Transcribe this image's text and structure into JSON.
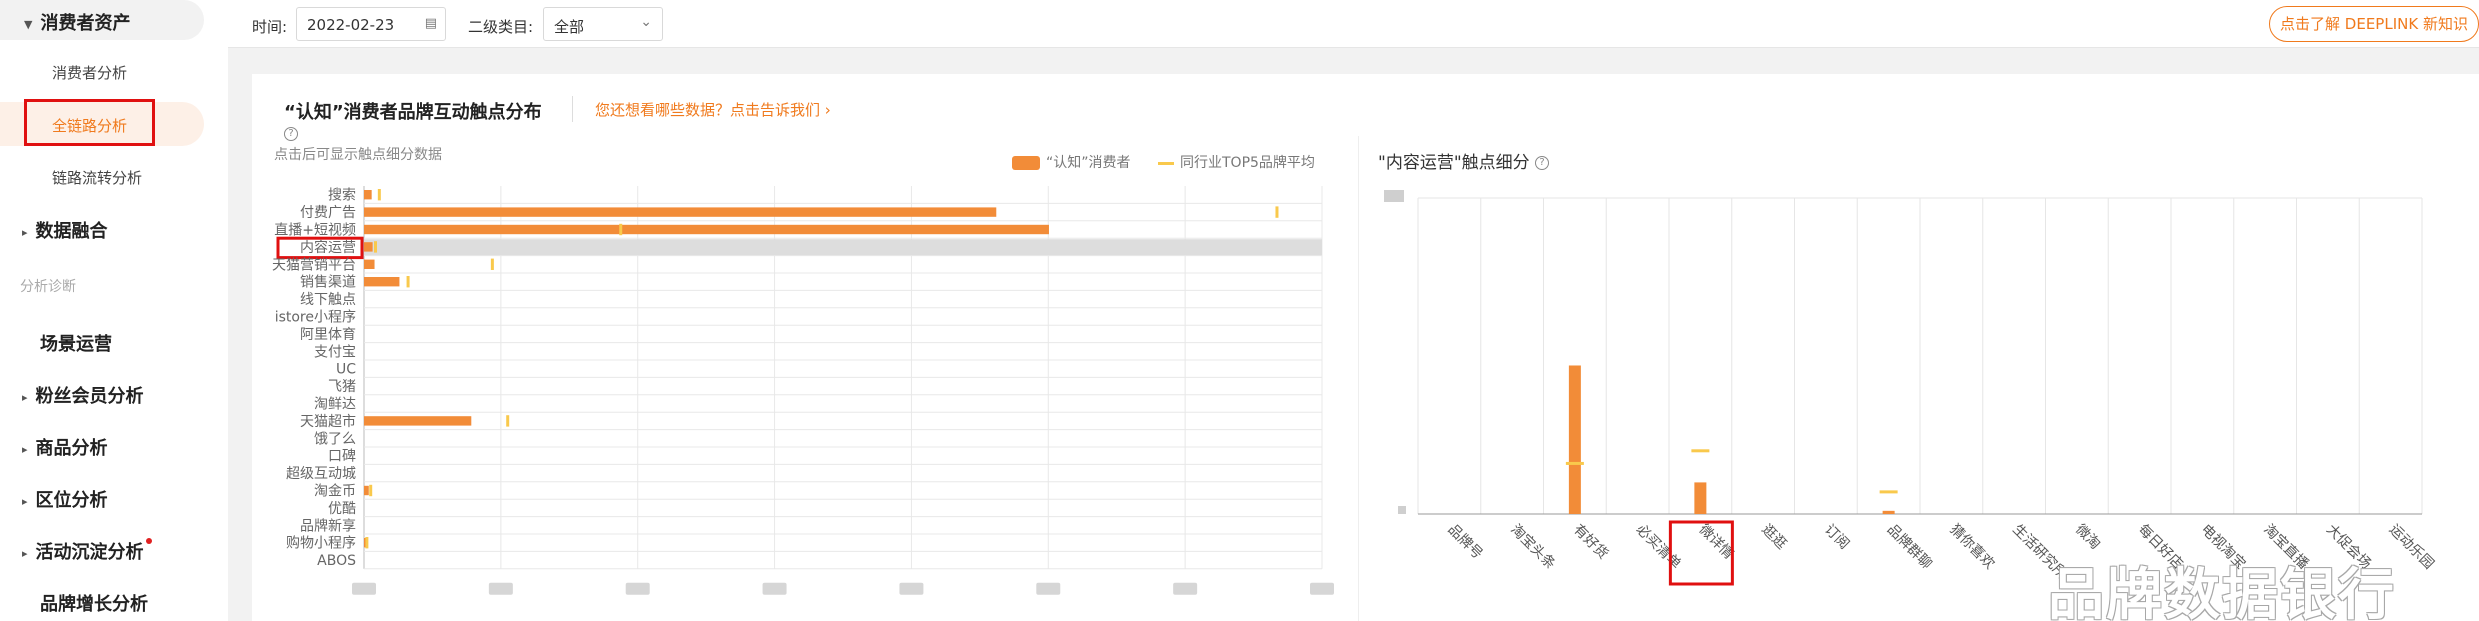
{
  "sidebar": {
    "group_consumer_assets": "消费者资产",
    "sub_consumer_analysis": "消费者分析",
    "sub_full_link": "全链路分析",
    "sub_link_flow": "链路流转分析",
    "group_data_fusion": "数据融合",
    "section_diagnosis": "分析诊断",
    "item_scene_ops": "场景运营",
    "group_fans": "粉丝会员分析",
    "group_product": "商品分析",
    "group_region": "区位分析",
    "group_activity": "活动沉淀分析",
    "group_brand_growth": "品牌增长分析"
  },
  "toolbar": {
    "time_label": "时间:",
    "date_value": "2022-02-23",
    "category_label": "二级类目:",
    "category_value": "全部",
    "deeplink_button": "点击了解 DEEPLINK 新知识"
  },
  "card": {
    "title": "“认知”消费者品牌互动触点分布",
    "feedback_link": "您还想看哪些数据？点击告诉我们",
    "hint": "点击后可显示触点细分数据"
  },
  "legend": {
    "consumers": "“认知”消费者",
    "top5_avg": "同行业TOP5品牌平均"
  },
  "colors": {
    "bar": "#f28c38",
    "avg_mark": "#f9c94c",
    "accent": "#f07a1d",
    "highlight": "#e01010",
    "selected_row": "#dddddd"
  },
  "chart_data": [
    {
      "type": "bar",
      "orientation": "horizontal",
      "categories": [
        "搜索",
        "付费广告",
        "直播+短视频",
        "内容运营",
        "天猫营销平台",
        "销售渠道",
        "线下触点",
        "istore小程序",
        "阿里体育",
        "支付宝",
        "UC",
        "飞猪",
        "淘鲜达",
        "天猫超市",
        "饿了么",
        "口碑",
        "超级互动城",
        "淘金币",
        "优酷",
        "品牌新享",
        "购物小程序",
        "ABOS"
      ],
      "series": [
        {
          "name": "“认知”消费者",
          "values": [
            0.8,
            66,
            71.5,
            0.9,
            1.1,
            3.7,
            0,
            0,
            0,
            0,
            0,
            0,
            0,
            11.2,
            0,
            0,
            0,
            0.5,
            0,
            0,
            0.4,
            0
          ]
        },
        {
          "name": "同行业TOP5品牌平均",
          "values": [
            1.6,
            95.3,
            26.8,
            1.2,
            13.4,
            4.6,
            0,
            0,
            0,
            0,
            0,
            0,
            0,
            15,
            0,
            0,
            0,
            0.7,
            0,
            0,
            0.3,
            0
          ]
        }
      ],
      "selected_category": "内容运营",
      "xlim": [
        0,
        100
      ]
    },
    {
      "type": "bar",
      "title": "\"内容运营\"触点细分",
      "categories": [
        "品牌号",
        "淘宝头条",
        "有好货",
        "必买清单",
        "微详情",
        "逛逛",
        "订阅",
        "品牌群聊",
        "猜你喜欢",
        "生活研究所",
        "微淘",
        "每日好店",
        "电视淘宝",
        "淘宝直播",
        "大促会场",
        "运动乐园"
      ],
      "series": [
        {
          "name": "“认知”消费者",
          "values": [
            0,
            0,
            47,
            0,
            10,
            0,
            0,
            1,
            0,
            0,
            0,
            0,
            0,
            0,
            0,
            0
          ]
        },
        {
          "name": "同行业TOP5品牌平均",
          "values": [
            0,
            0,
            16,
            0,
            20,
            0,
            0,
            7,
            0,
            0,
            0,
            0,
            0,
            0,
            0,
            0
          ]
        }
      ],
      "highlighted_category": "微详情",
      "ylim": [
        0,
        100
      ]
    }
  ]
}
